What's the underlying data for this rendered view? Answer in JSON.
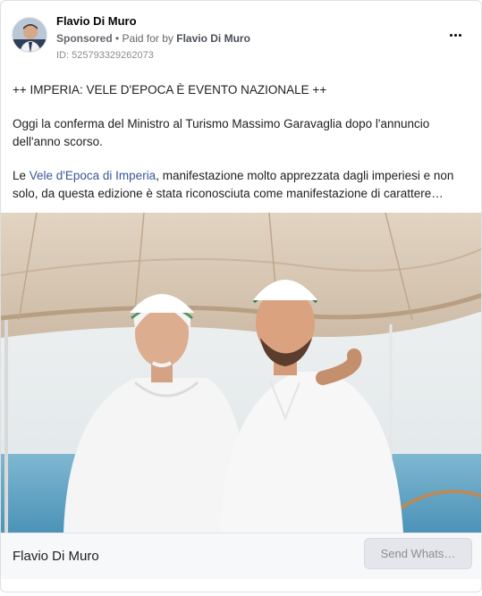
{
  "post": {
    "author": "Flavio Di Muro",
    "sponsored_label": "Sponsored",
    "separator": " • ",
    "paid_prefix": "Paid for by ",
    "paid_by": "Flavio Di Muro",
    "ad_id": "ID: 525793329262073",
    "more_icon": "more-horizontal-icon"
  },
  "body": {
    "headline": "++ IMPERIA: VELE D'EPOCA È EVENTO NAZIONALE ++",
    "paragraph1": "Oggi la conferma del Ministro al Turismo Massimo Garavaglia dopo l'annuncio dell'anno scorso.",
    "paragraph2_prefix": "Le ",
    "paragraph2_link": "Vele d'Epoca di Imperia",
    "paragraph2_rest": ", manifestazione molto apprezzata dagli imperiesi e non solo, da questa edizione è stata riconosciuta come manifestazione di carattere…"
  },
  "footer": {
    "page_name": "Flavio Di Muro",
    "cta_label": "Send Whats…"
  },
  "colors": {
    "link": "#385898",
    "muted": "#65676b",
    "cta_bg": "#e4e6eb"
  }
}
